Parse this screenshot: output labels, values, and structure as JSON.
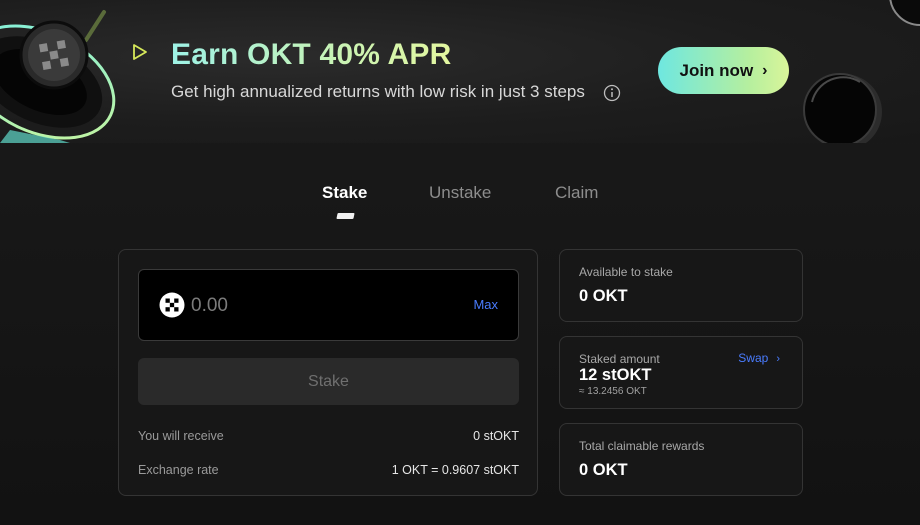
{
  "banner": {
    "title": "Earn OKT 40% APR",
    "subtitle": "Get high annualized returns with low risk in just 3 steps",
    "join_label": "Join now",
    "join_chevron": "›"
  },
  "tabs": [
    {
      "label": "Stake",
      "active": true
    },
    {
      "label": "Unstake",
      "active": false
    },
    {
      "label": "Claim",
      "active": false
    }
  ],
  "stake_form": {
    "amount_placeholder": "0.00",
    "max_label": "Max",
    "stake_button_label": "Stake",
    "receive_label": "You will receive",
    "receive_value": "0 stOKT",
    "rate_label": "Exchange rate",
    "rate_value": "1 OKT = 0.9607 stOKT"
  },
  "cards": {
    "available": {
      "label": "Available to stake",
      "value": "0 OKT"
    },
    "staked": {
      "label": "Staked amount",
      "value": "12 stOKT",
      "sub": "≈ 13.2456 OKT",
      "swap_label": "Swap",
      "swap_chevron": "›"
    },
    "rewards": {
      "label": "Total claimable rewards",
      "value": "0 OKT"
    }
  },
  "colors": {
    "accent_link": "#4a7cff",
    "gradient_start": "#6ee7e0",
    "gradient_end": "#d9f59a",
    "background": "#161616"
  },
  "icons": [
    "okt-coin-icon",
    "play-triangle-icon",
    "info-icon",
    "chevron-right-icon"
  ]
}
